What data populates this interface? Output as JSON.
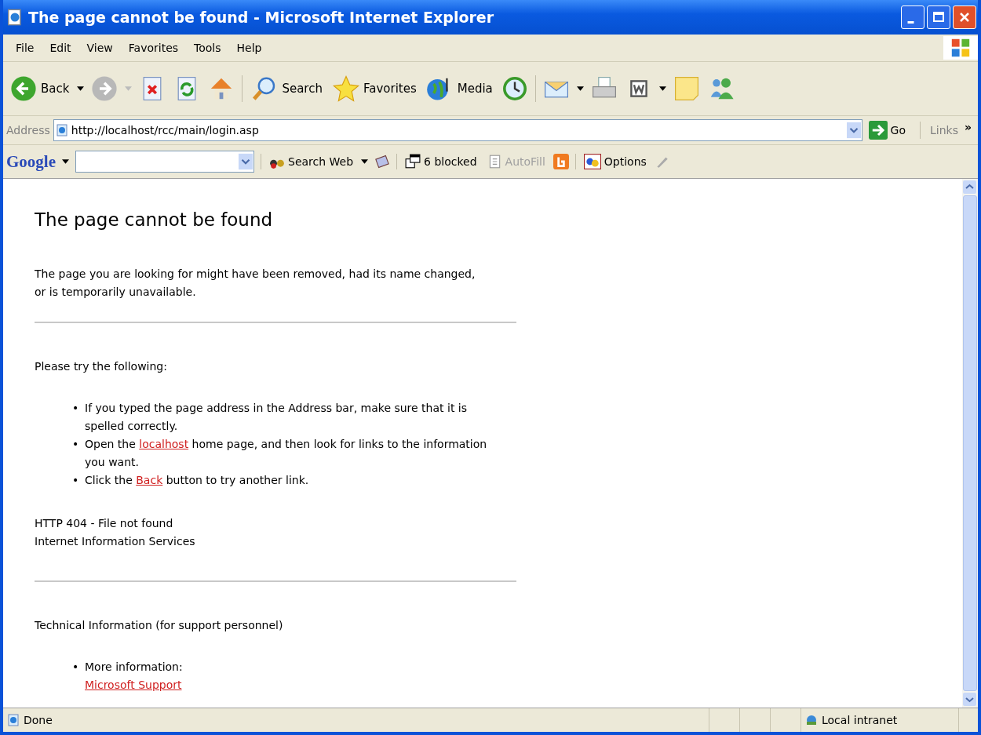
{
  "window": {
    "title": "The page cannot be found - Microsoft Internet Explorer"
  },
  "menu": [
    "File",
    "Edit",
    "View",
    "Favorites",
    "Tools",
    "Help"
  ],
  "toolbar": {
    "back": "Back",
    "search": "Search",
    "favorites": "Favorites",
    "media": "Media"
  },
  "address": {
    "label": "Address",
    "url": "http://localhost/rcc/main/login.asp",
    "go": "Go",
    "links": "Links",
    "more": "»"
  },
  "google_bar": {
    "logo": "Google",
    "search_web": "Search Web",
    "blocked": "6 blocked",
    "autofill": "AutoFill",
    "autofill_disabled": true,
    "options": "Options"
  },
  "page": {
    "heading": "The page cannot be found",
    "intro": "The page you are looking for might have been removed, had its name changed, or is temporarily unavailable.",
    "try_heading": "Please try the following:",
    "bullet": "•",
    "tips": [
      {
        "before": "If you typed the page address in the Address bar, make sure that it is spelled correctly."
      },
      {
        "before": "Open the ",
        "link": "localhost",
        "after": " home page, and then look for links to the information you want."
      },
      {
        "before": "Click the ",
        "link": "Back",
        "after": " button to try another link."
      }
    ],
    "error_code": "HTTP 404 - File not found",
    "server": "Internet Information Services",
    "tech_heading": "Technical Information (for support personnel)",
    "more_info": "More information:",
    "support_link": "Microsoft Support"
  },
  "status_bar": {
    "text": "Done",
    "zone": "Local intranet"
  }
}
